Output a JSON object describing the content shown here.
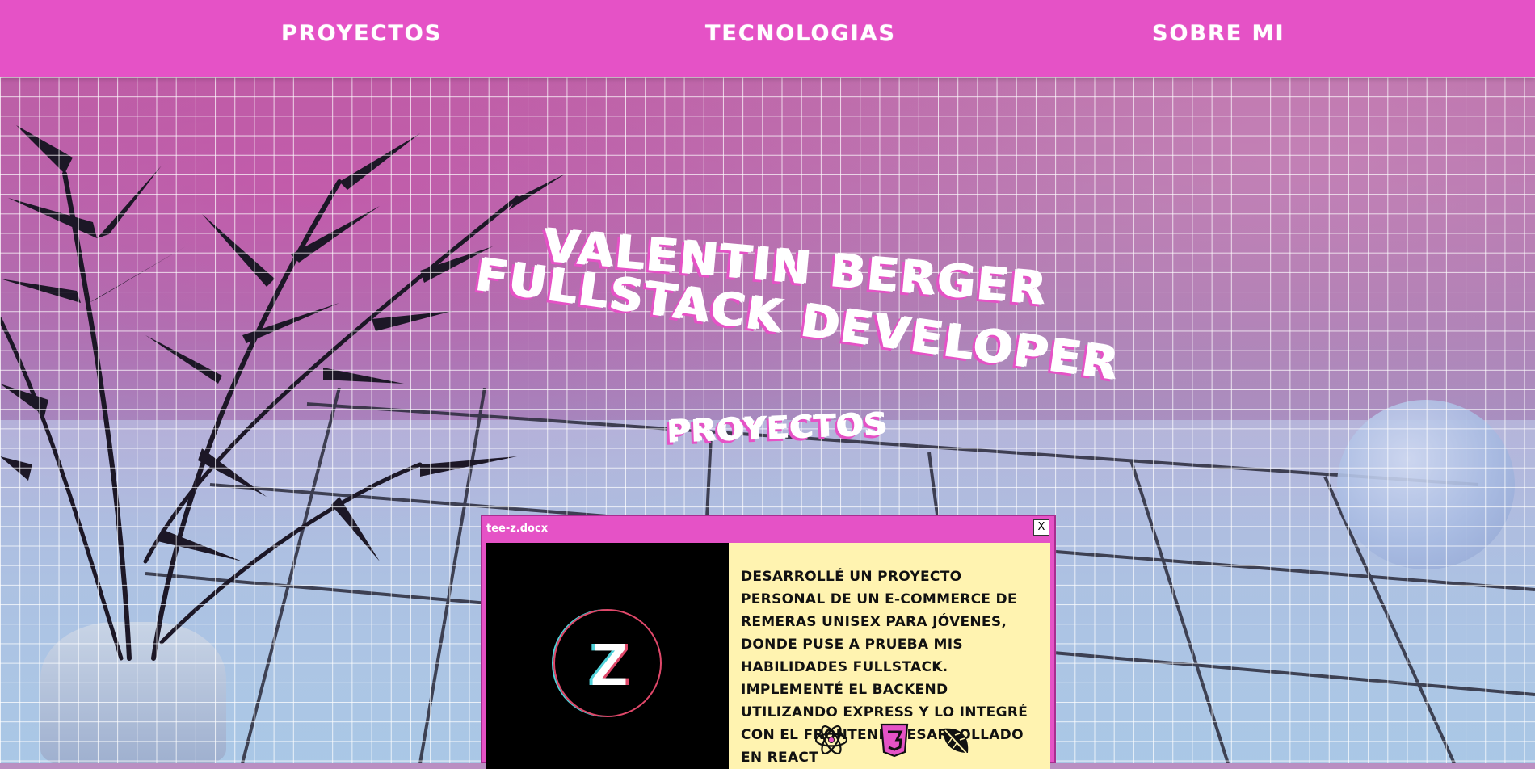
{
  "nav": {
    "items": [
      {
        "label": "PROYECTOS"
      },
      {
        "label": "TECNOLOGIAS"
      },
      {
        "label": "SOBRE MI"
      }
    ]
  },
  "hero": {
    "name": "VALENTIN BERGER",
    "role": "FULLSTACK DEVELOPER"
  },
  "projects": {
    "section_title": "PROYECTOS",
    "window": {
      "filename": "tee-z.docx",
      "close_label": "X",
      "logo_letter": "Z",
      "description": "Desarrollé un proyecto personal de un e-commerce de remeras unisex para jóvenes, donde puse a prueba mis habilidades fullstack. Implementé el backend utilizando Express y lo integré con el frontend desarrollado en React",
      "tech_icons": [
        "react-icon",
        "css3-icon",
        "leaf-icon"
      ]
    }
  },
  "colors": {
    "accent": "#e552c6",
    "window_body": "#fff3b0"
  }
}
